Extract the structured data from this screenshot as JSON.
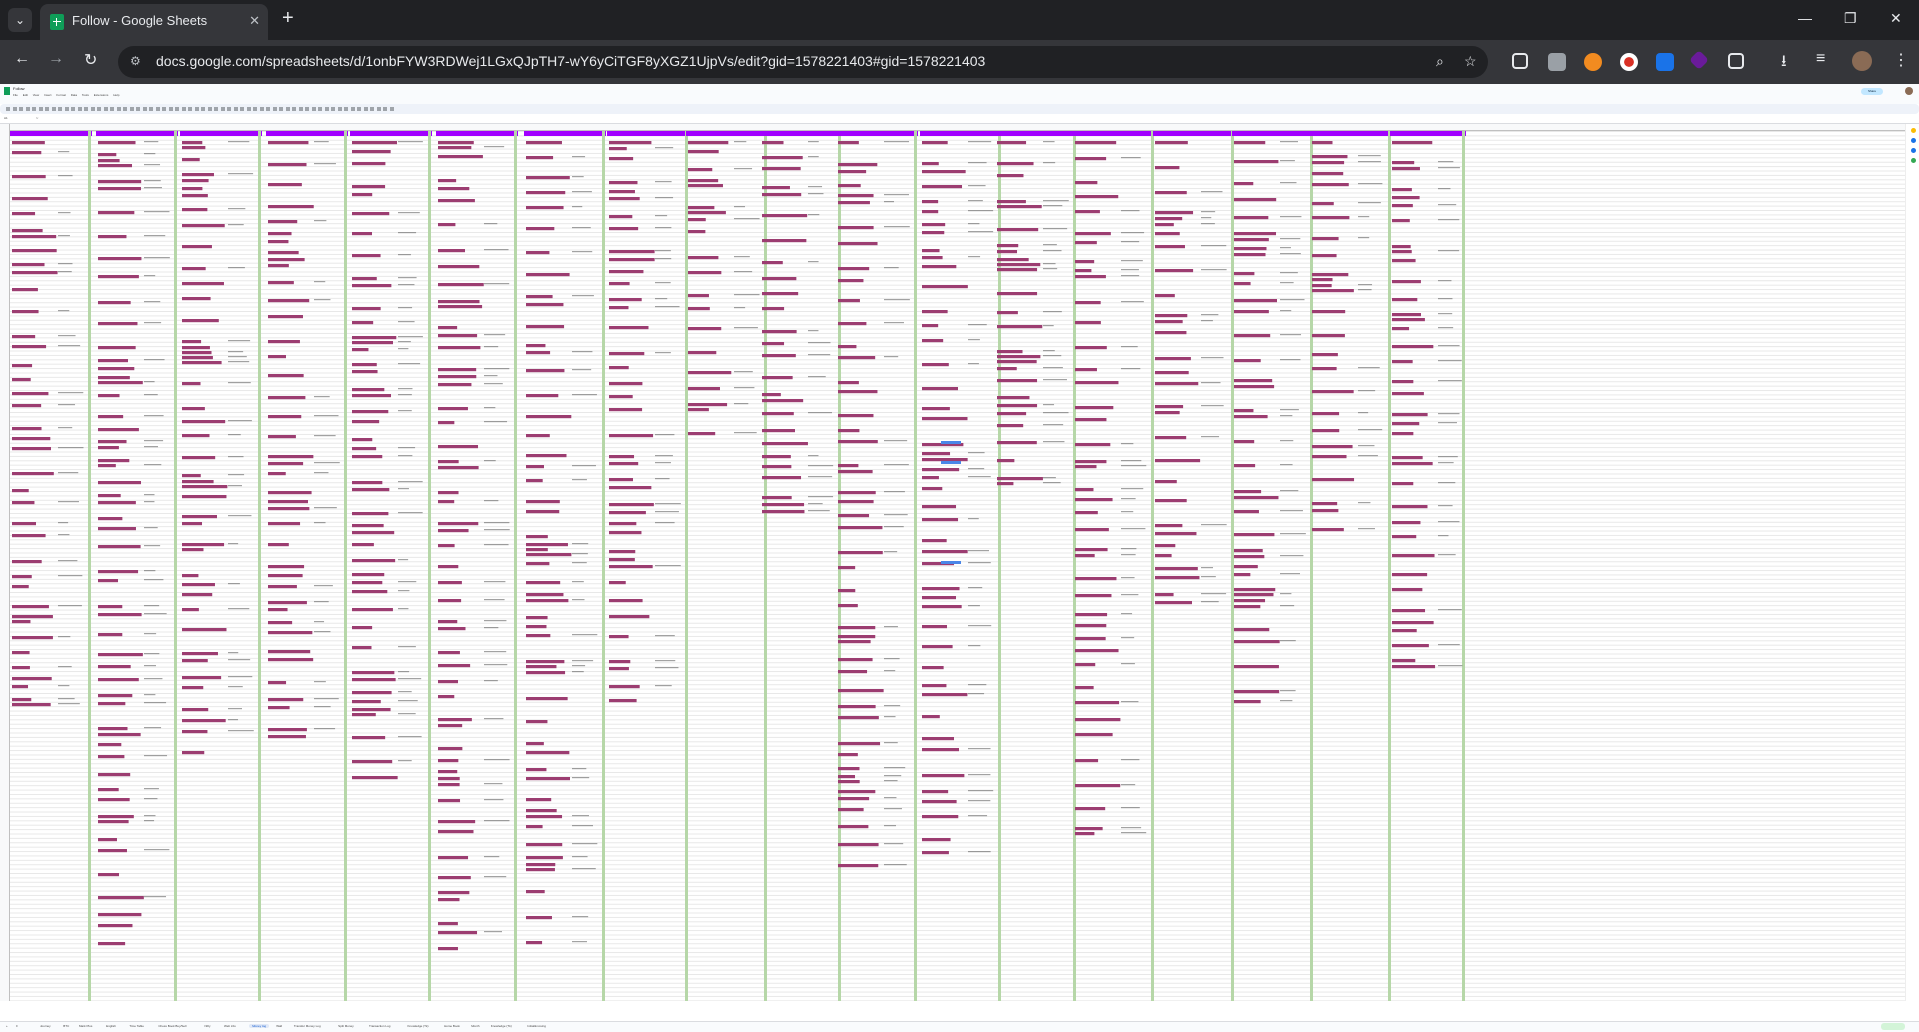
{
  "browser": {
    "tab_title": "Follow - Google Sheets",
    "new_tab": "+",
    "url": "docs.google.com/spreadsheets/d/1onbFYW3RDWej1LGxQJpTH7-wY6yCiTGF8yXGZ1UjpVs/edit?gid=1578221403#gid=1578221403",
    "minimize": "—",
    "maximize": "❐",
    "close": "✕",
    "back": "←",
    "forward": "→",
    "reload": "↻"
  },
  "sheets": {
    "doc_title": "Follow",
    "menu": [
      "File",
      "Edit",
      "View",
      "Insert",
      "Format",
      "Data",
      "Tools",
      "Extensions",
      "Help"
    ],
    "share_label": "Share",
    "name_box": "A1",
    "colors": {
      "header_band": "#a100ff",
      "entry_bar": "#9c3d71",
      "column_separator": "#b6d7a8",
      "selection": "#4a86e8"
    },
    "sheet_tabs": [
      "Journey",
      "BTC",
      "Mark Plus",
      "English",
      "Time Table",
      "Chess Book Buy/Sell",
      "Nifty",
      "Web info",
      "Money log",
      "Wall",
      "Transfer Money Log",
      "Split Money",
      "Transaction Log",
      "Knowledge (Tk)",
      "Home Book",
      "Month",
      "Knowledge (Tk)",
      "Initial&moving"
    ],
    "active_sheet": "Money log"
  }
}
